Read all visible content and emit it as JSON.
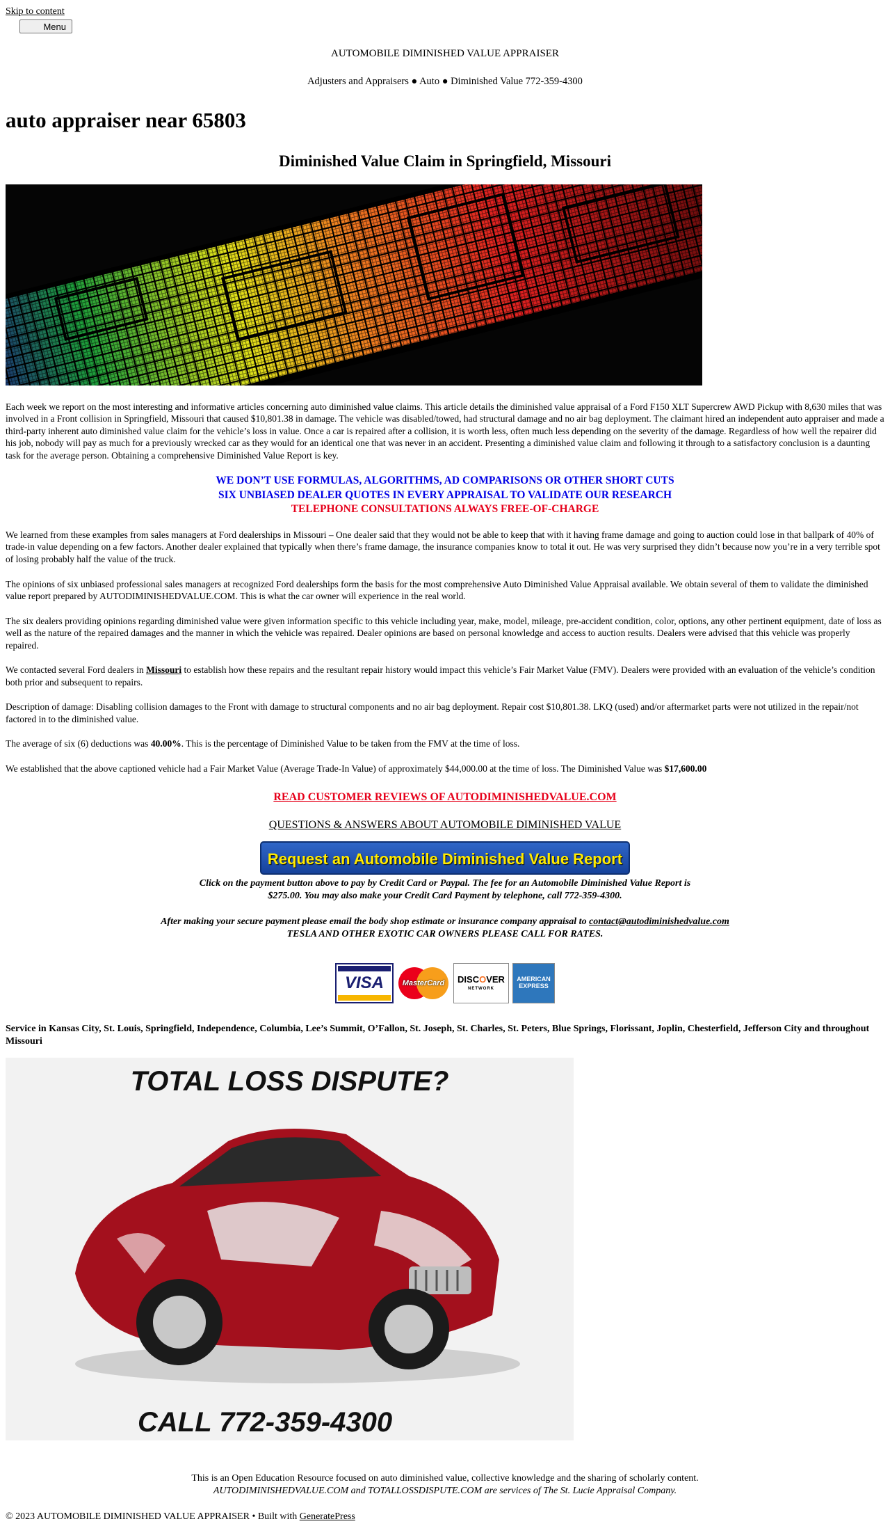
{
  "header": {
    "skip_link": "Skip to content",
    "menu_label": "Menu",
    "site_title": "AUTOMOBILE DIMINISHED VALUE APPRAISER",
    "site_description": "Adjusters and Appraisers ● Auto ● Diminished Value 772-359-4300"
  },
  "article": {
    "title": "auto appraiser near 65803",
    "subtitle": "Diminished Value Claim in Springfield, Missouri",
    "intro": "Each week we report on the most interesting and informative articles concerning auto diminished value claims. This article details the diminished value appraisal of a Ford F150 XLT Supercrew AWD Pickup with 8,630 miles that was involved in a Front collision in Springfield, Missouri that caused $10,801.38 in damage. The vehicle was disabled/towed, had structural damage and no air bag deployment. The claimant hired an independent auto appraiser and made a third-party inherent auto diminished value claim for the vehicle’s loss in value. Once a car is repaired after a collision, it is worth less, often much less depending on the severity of the damage. Regardless of how well the repairer did his job, nobody will pay as much for a previously wrecked car as they would for an identical one that was never in an accident. Presenting a diminished value claim and following it through to a satisfactory conclusion is a daunting task for the average person. Obtaining a comprehensive Diminished Value Report is key.",
    "banner_line1": "WE DON’T USE FORMULAS, ALGORITHMS, AD COMPARISONS OR OTHER SHORT CUTS",
    "banner_line2": "SIX UNBIASED DEALER QUOTES IN EVERY APPRAISAL TO VALIDATE OUR RESEARCH",
    "banner_line3": "TELEPHONE CONSULTATIONS ALWAYS FREE-OF-CHARGE",
    "p2": "We learned from these examples from sales managers at Ford dealerships in Missouri – One dealer said that they would not be able to keep that with it having frame damage and going to auction could lose in that ballpark of 40% of trade-in value depending on a few factors. Another dealer explained that typically when there’s frame damage, the insurance companies know to total it out. He was very surprised they didn’t because now you’re in a very terrible spot of losing probably half the value of the truck.",
    "p3": "The opinions of six unbiased professional sales managers at recognized Ford dealerships form the basis for the most comprehensive Auto Diminished Value Appraisal available. We obtain several of them to validate the diminished value report prepared by AUTODIMINISHEDVALUE.COM. This is what the car owner will experience in the real world.",
    "p4": "The six dealers providing opinions regarding diminished value were given information specific to this vehicle including year, make, model, mileage, pre-accident condition, color, options, any other pertinent equipment, date of loss as well as the nature of the repaired damages and the manner in which the vehicle was repaired. Dealer opinions are based on personal knowledge and access to auction results. Dealers were advised that this vehicle was properly repaired.",
    "p5_before": "We contacted several Ford dealers in ",
    "p5_link": "Missouri",
    "p5_after": " to establish how these repairs and the resultant repair history would impact this vehicle’s Fair Market Value (FMV). Dealers were provided with an evaluation of the vehicle’s condition both prior and subsequent to repairs.",
    "p6": "Description of damage: Disabling collision damages to the Front with damage to structural components and no air bag deployment. Repair cost $10,801.38. LKQ (used) and/or aftermarket parts were not utilized in the repair/not factored in to the diminished value.",
    "p7_before": "The average of six (6) deductions was ",
    "p7_bold": "40.00%",
    "p7_after": ". This is the percentage of Diminished Value to be taken from the FMV at the time of loss.",
    "p8_before": "We established that the above captioned vehicle had a Fair Market Value (Average Trade-In Value) of approximately $44,000.00 at the time of loss. The Diminished Value was ",
    "p8_bold": "$17,600.00",
    "reviews_link": "READ CUSTOMER REVIEWS OF AUTODIMINISHEDVALUE.COM",
    "qa_link": "QUESTIONS & ANSWERS ABOUT AUTOMOBILE DIMINISHED VALUE",
    "request_button": "Request an Automobile Diminished Value Report",
    "payment_line1": "Click on the payment button above to pay by Credit Card or Paypal. The fee for an Automobile Diminished Value Report is",
    "payment_line2": "$275.00. You may also make your Credit Card Payment by telephone, call 772-359-4300.",
    "after_payment": "After making your secure payment please email the body shop estimate or insurance company appraisal to ",
    "email": "contact@autodiminishedvalue.com",
    "exotic": "TESLA AND OTHER EXOTIC CAR OWNERS PLEASE CALL FOR RATES.",
    "cards": {
      "visa": "VISA",
      "mastercard": "MasterCard",
      "discover_a": "DISC",
      "discover_o": "O",
      "discover_b": "VER",
      "discover_net": "NETWORK",
      "amex_1": "AMERICAN",
      "amex_2": "EXPRESS"
    },
    "service_area": "Service in Kansas City, St. Louis, Springfield, Independence, Columbia, Lee’s Summit, O’Fallon, St. Joseph, St. Charles, St. Peters, Blue Springs, Florissant, Joplin, Chesterfield, Jefferson City and throughout Missouri",
    "promo_heading": "TOTAL LOSS DISPUTE?",
    "promo_call": "CALL 772-359-4300",
    "footer_line1": "This is an Open Education Resource focused on auto diminished value, collective knowledge and the sharing of scholarly content.",
    "footer_line2": "AUTODIMINISHEDVALUE.COM and TOTALLOSSDISPUTE.COM are services of The St. Lucie Appraisal Company."
  },
  "footer": {
    "copyright": "© 2023 AUTOMOBILE DIMINISHED VALUE APPRAISER • Built with ",
    "built_with": "GeneratePress"
  },
  "colors": {
    "blue_banner": "#0000e6",
    "red_banner": "#e6001a",
    "button_bg": "#1f4fb0",
    "button_text": "#ffea00"
  }
}
